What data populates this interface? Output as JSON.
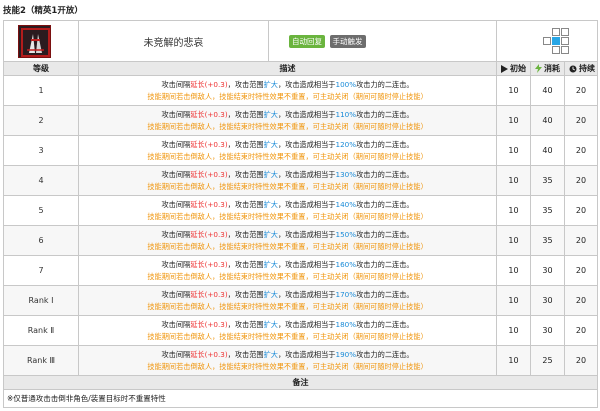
{
  "section_title": "技能2（精英1开放）",
  "skill": {
    "name": "未竞解的悲哀",
    "tags": [
      "自动回复",
      "手动触发"
    ],
    "range_grid": [
      [
        0,
        0,
        0,
        1,
        1
      ],
      [
        0,
        0,
        1,
        2,
        1
      ],
      [
        0,
        0,
        0,
        1,
        1
      ]
    ]
  },
  "columns": {
    "level": "等级",
    "description": "描述",
    "initial": "初始",
    "cost": "消耗",
    "duration": "持续"
  },
  "rows": [
    {
      "level": "1",
      "l1_pre": "攻击间隔",
      "l1_red": "延长(+0.3)",
      "l1_mid": "，攻击范围",
      "l1_blue": "扩大",
      "l1_post": "，攻击造成相当于",
      "l1_pct": "100%",
      "l1_end": "攻击力的二连击。",
      "l2": "技能期间若击倒敌人，技能结束时特性效果不重置，可主动关闭（期间可随时停止技能）",
      "initial": "10",
      "cost": "40",
      "duration": "20"
    },
    {
      "level": "2",
      "l1_pre": "攻击间隔",
      "l1_red": "延长(+0.3)",
      "l1_mid": "，攻击范围",
      "l1_blue": "扩大",
      "l1_post": "，攻击造成相当于",
      "l1_pct": "110%",
      "l1_end": "攻击力的二连击。",
      "l2": "技能期间若击倒敌人，技能结束时特性效果不重置，可主动关闭（期间可随时停止技能）",
      "initial": "10",
      "cost": "40",
      "duration": "20"
    },
    {
      "level": "3",
      "l1_pre": "攻击间隔",
      "l1_red": "延长(+0.3)",
      "l1_mid": "，攻击范围",
      "l1_blue": "扩大",
      "l1_post": "，攻击造成相当于",
      "l1_pct": "120%",
      "l1_end": "攻击力的二连击。",
      "l2": "技能期间若击倒敌人，技能结束时特性效果不重置，可主动关闭（期间可随时停止技能）",
      "initial": "10",
      "cost": "40",
      "duration": "20"
    },
    {
      "level": "4",
      "l1_pre": "攻击间隔",
      "l1_red": "延长(+0.3)",
      "l1_mid": "，攻击范围",
      "l1_blue": "扩大",
      "l1_post": "，攻击造成相当于",
      "l1_pct": "130%",
      "l1_end": "攻击力的二连击。",
      "l2": "技能期间若击倒敌人，技能结束时特性效果不重置，可主动关闭（期间可随时停止技能）",
      "initial": "10",
      "cost": "35",
      "duration": "20"
    },
    {
      "level": "5",
      "l1_pre": "攻击间隔",
      "l1_red": "延长(+0.3)",
      "l1_mid": "，攻击范围",
      "l1_blue": "扩大",
      "l1_post": "，攻击造成相当于",
      "l1_pct": "140%",
      "l1_end": "攻击力的二连击。",
      "l2": "技能期间若击倒敌人，技能结束时特性效果不重置，可主动关闭（期间可随时停止技能）",
      "initial": "10",
      "cost": "35",
      "duration": "20"
    },
    {
      "level": "6",
      "l1_pre": "攻击间隔",
      "l1_red": "延长(+0.3)",
      "l1_mid": "，攻击范围",
      "l1_blue": "扩大",
      "l1_post": "，攻击造成相当于",
      "l1_pct": "150%",
      "l1_end": "攻击力的二连击。",
      "l2": "技能期间若击倒敌人，技能结束时特性效果不重置，可主动关闭（期间可随时停止技能）",
      "initial": "10",
      "cost": "35",
      "duration": "20"
    },
    {
      "level": "7",
      "l1_pre": "攻击间隔",
      "l1_red": "延长(+0.3)",
      "l1_mid": "，攻击范围",
      "l1_blue": "扩大",
      "l1_post": "，攻击造成相当于",
      "l1_pct": "160%",
      "l1_end": "攻击力的二连击。",
      "l2": "技能期间若击倒敌人，技能结束时特性效果不重置，可主动关闭（期间可随时停止技能）",
      "initial": "10",
      "cost": "30",
      "duration": "20"
    },
    {
      "level": "Rank Ⅰ",
      "l1_pre": "攻击间隔",
      "l1_red": "延长(+0.3)",
      "l1_mid": "，攻击范围",
      "l1_blue": "扩大",
      "l1_post": "，攻击造成相当于",
      "l1_pct": "170%",
      "l1_end": "攻击力的二连击。",
      "l2": "技能期间若击倒敌人，技能结束时特性效果不重置，可主动关闭（期间可随时停止技能）",
      "initial": "10",
      "cost": "30",
      "duration": "20"
    },
    {
      "level": "Rank Ⅱ",
      "l1_pre": "攻击间隔",
      "l1_red": "延长(+0.3)",
      "l1_mid": "，攻击范围",
      "l1_blue": "扩大",
      "l1_post": "，攻击造成相当于",
      "l1_pct": "180%",
      "l1_end": "攻击力的二连击。",
      "l2": "技能期间若击倒敌人，技能结束时特性效果不重置，可主动关闭（期间可随时停止技能）",
      "initial": "10",
      "cost": "30",
      "duration": "20"
    },
    {
      "level": "Rank Ⅲ",
      "l1_pre": "攻击间隔",
      "l1_red": "延长(+0.3)",
      "l1_mid": "，攻击范围",
      "l1_blue": "扩大",
      "l1_post": "，攻击造成相当于",
      "l1_pct": "190%",
      "l1_end": "攻击力的二连击。",
      "l2": "技能期间若击倒敌人，技能结束时特性效果不重置，可主动关闭（期间可随时停止技能）",
      "initial": "10",
      "cost": "25",
      "duration": "20"
    }
  ],
  "notes": {
    "header": "备注",
    "text": "※仅普通攻击击倒非角色/装置目标时不重置特性"
  },
  "colors": {
    "reduce_red": "#ee3333",
    "expand_blue": "#1a8bd8",
    "line2_orange": "#f0960e",
    "tag_green": "#6ab43e",
    "tag_grey": "#6d6d6d",
    "range_blue": "#27a6e6"
  },
  "icons": {
    "initial": "play-icon",
    "cost": "lightning-icon",
    "duration": "clock-icon"
  }
}
